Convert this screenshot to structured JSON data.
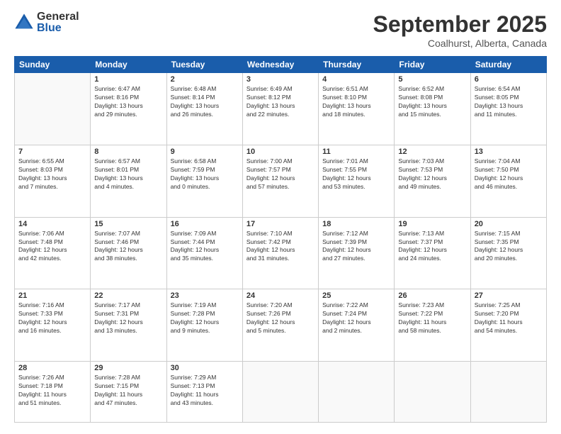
{
  "header": {
    "logo_general": "General",
    "logo_blue": "Blue",
    "month_title": "September 2025",
    "location": "Coalhurst, Alberta, Canada"
  },
  "days_of_week": [
    "Sunday",
    "Monday",
    "Tuesday",
    "Wednesday",
    "Thursday",
    "Friday",
    "Saturday"
  ],
  "weeks": [
    [
      {
        "day": "",
        "info": ""
      },
      {
        "day": "1",
        "info": "Sunrise: 6:47 AM\nSunset: 8:16 PM\nDaylight: 13 hours\nand 29 minutes."
      },
      {
        "day": "2",
        "info": "Sunrise: 6:48 AM\nSunset: 8:14 PM\nDaylight: 13 hours\nand 26 minutes."
      },
      {
        "day": "3",
        "info": "Sunrise: 6:49 AM\nSunset: 8:12 PM\nDaylight: 13 hours\nand 22 minutes."
      },
      {
        "day": "4",
        "info": "Sunrise: 6:51 AM\nSunset: 8:10 PM\nDaylight: 13 hours\nand 18 minutes."
      },
      {
        "day": "5",
        "info": "Sunrise: 6:52 AM\nSunset: 8:08 PM\nDaylight: 13 hours\nand 15 minutes."
      },
      {
        "day": "6",
        "info": "Sunrise: 6:54 AM\nSunset: 8:05 PM\nDaylight: 13 hours\nand 11 minutes."
      }
    ],
    [
      {
        "day": "7",
        "info": "Sunrise: 6:55 AM\nSunset: 8:03 PM\nDaylight: 13 hours\nand 7 minutes."
      },
      {
        "day": "8",
        "info": "Sunrise: 6:57 AM\nSunset: 8:01 PM\nDaylight: 13 hours\nand 4 minutes."
      },
      {
        "day": "9",
        "info": "Sunrise: 6:58 AM\nSunset: 7:59 PM\nDaylight: 13 hours\nand 0 minutes."
      },
      {
        "day": "10",
        "info": "Sunrise: 7:00 AM\nSunset: 7:57 PM\nDaylight: 12 hours\nand 57 minutes."
      },
      {
        "day": "11",
        "info": "Sunrise: 7:01 AM\nSunset: 7:55 PM\nDaylight: 12 hours\nand 53 minutes."
      },
      {
        "day": "12",
        "info": "Sunrise: 7:03 AM\nSunset: 7:53 PM\nDaylight: 12 hours\nand 49 minutes."
      },
      {
        "day": "13",
        "info": "Sunrise: 7:04 AM\nSunset: 7:50 PM\nDaylight: 12 hours\nand 46 minutes."
      }
    ],
    [
      {
        "day": "14",
        "info": "Sunrise: 7:06 AM\nSunset: 7:48 PM\nDaylight: 12 hours\nand 42 minutes."
      },
      {
        "day": "15",
        "info": "Sunrise: 7:07 AM\nSunset: 7:46 PM\nDaylight: 12 hours\nand 38 minutes."
      },
      {
        "day": "16",
        "info": "Sunrise: 7:09 AM\nSunset: 7:44 PM\nDaylight: 12 hours\nand 35 minutes."
      },
      {
        "day": "17",
        "info": "Sunrise: 7:10 AM\nSunset: 7:42 PM\nDaylight: 12 hours\nand 31 minutes."
      },
      {
        "day": "18",
        "info": "Sunrise: 7:12 AM\nSunset: 7:39 PM\nDaylight: 12 hours\nand 27 minutes."
      },
      {
        "day": "19",
        "info": "Sunrise: 7:13 AM\nSunset: 7:37 PM\nDaylight: 12 hours\nand 24 minutes."
      },
      {
        "day": "20",
        "info": "Sunrise: 7:15 AM\nSunset: 7:35 PM\nDaylight: 12 hours\nand 20 minutes."
      }
    ],
    [
      {
        "day": "21",
        "info": "Sunrise: 7:16 AM\nSunset: 7:33 PM\nDaylight: 12 hours\nand 16 minutes."
      },
      {
        "day": "22",
        "info": "Sunrise: 7:17 AM\nSunset: 7:31 PM\nDaylight: 12 hours\nand 13 minutes."
      },
      {
        "day": "23",
        "info": "Sunrise: 7:19 AM\nSunset: 7:28 PM\nDaylight: 12 hours\nand 9 minutes."
      },
      {
        "day": "24",
        "info": "Sunrise: 7:20 AM\nSunset: 7:26 PM\nDaylight: 12 hours\nand 5 minutes."
      },
      {
        "day": "25",
        "info": "Sunrise: 7:22 AM\nSunset: 7:24 PM\nDaylight: 12 hours\nand 2 minutes."
      },
      {
        "day": "26",
        "info": "Sunrise: 7:23 AM\nSunset: 7:22 PM\nDaylight: 11 hours\nand 58 minutes."
      },
      {
        "day": "27",
        "info": "Sunrise: 7:25 AM\nSunset: 7:20 PM\nDaylight: 11 hours\nand 54 minutes."
      }
    ],
    [
      {
        "day": "28",
        "info": "Sunrise: 7:26 AM\nSunset: 7:18 PM\nDaylight: 11 hours\nand 51 minutes."
      },
      {
        "day": "29",
        "info": "Sunrise: 7:28 AM\nSunset: 7:15 PM\nDaylight: 11 hours\nand 47 minutes."
      },
      {
        "day": "30",
        "info": "Sunrise: 7:29 AM\nSunset: 7:13 PM\nDaylight: 11 hours\nand 43 minutes."
      },
      {
        "day": "",
        "info": ""
      },
      {
        "day": "",
        "info": ""
      },
      {
        "day": "",
        "info": ""
      },
      {
        "day": "",
        "info": ""
      }
    ]
  ]
}
